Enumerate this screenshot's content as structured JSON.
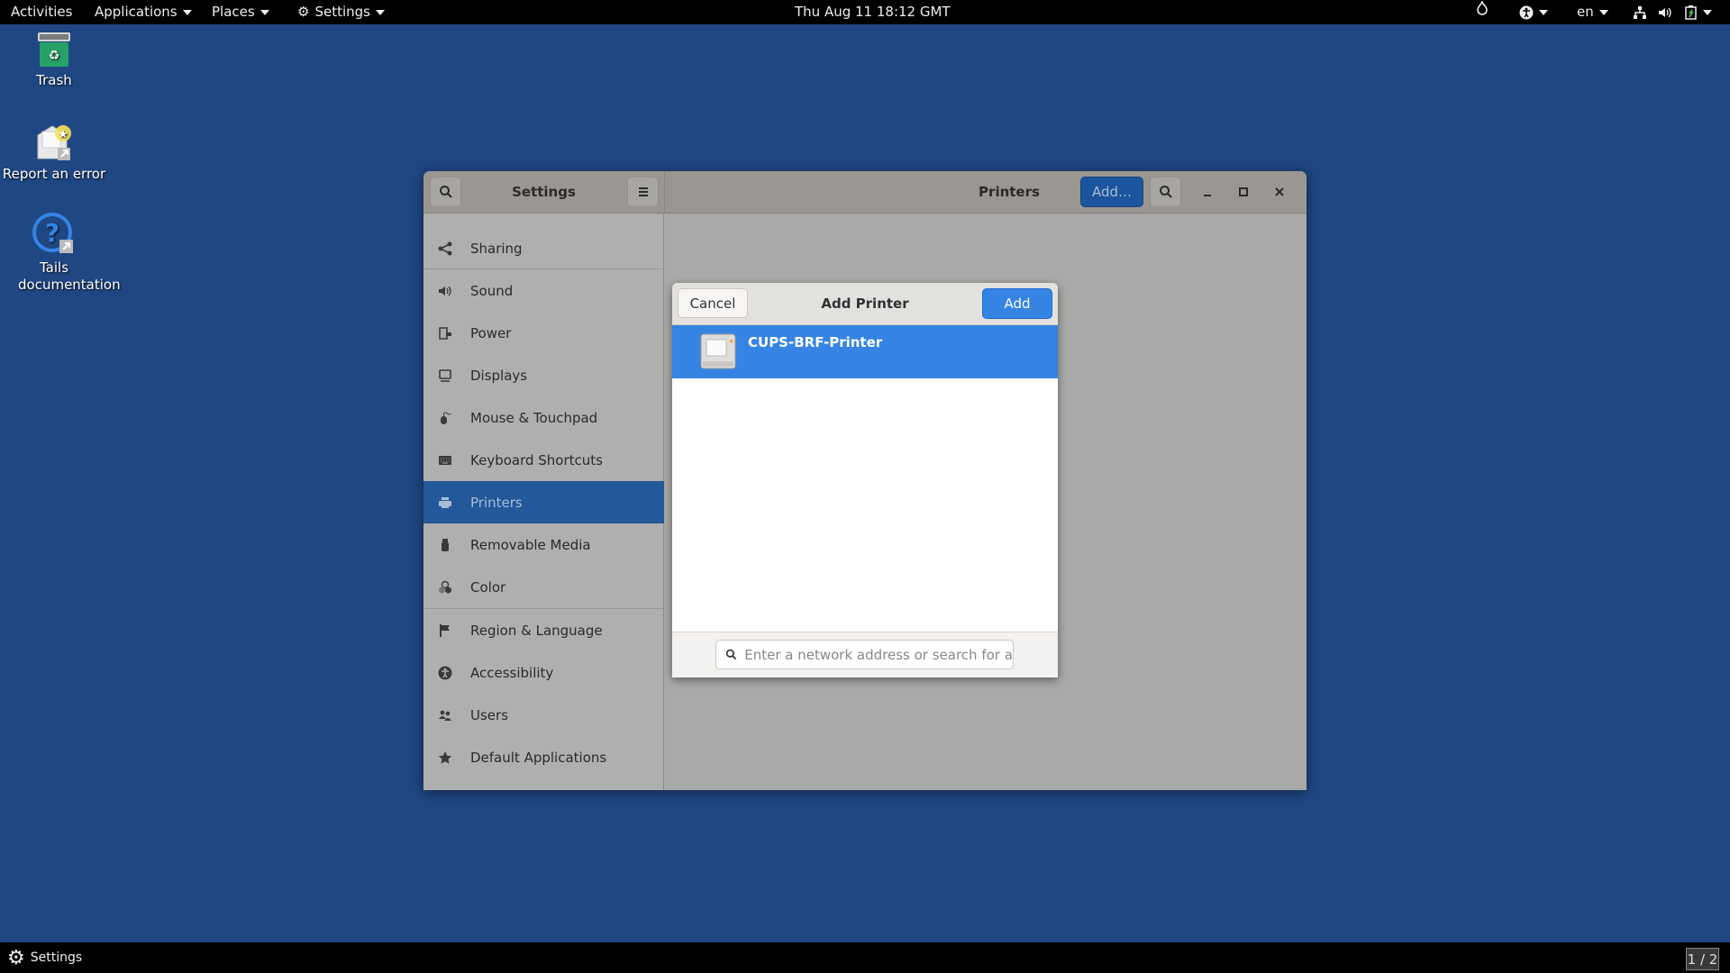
{
  "topbar": {
    "activities": "Activities",
    "applications": "Applications",
    "places": "Places",
    "settings_menu": "Settings",
    "clock": "Thu Aug 11  18:12 GMT",
    "language": "en"
  },
  "desktop": {
    "icons": [
      {
        "label": "Trash"
      },
      {
        "label": "Report an error"
      },
      {
        "label": "Tails documentation"
      }
    ]
  },
  "window": {
    "sidebar_title": "Settings",
    "main_title": "Printers",
    "add_button": "Add…",
    "sidebar": {
      "items": [
        {
          "label": "Sharing",
          "icon": "share-icon"
        },
        {
          "label": "Sound",
          "icon": "speaker-icon"
        },
        {
          "label": "Power",
          "icon": "battery-icon"
        },
        {
          "label": "Displays",
          "icon": "display-icon"
        },
        {
          "label": "Mouse & Touchpad",
          "icon": "mouse-icon"
        },
        {
          "label": "Keyboard Shortcuts",
          "icon": "keyboard-icon"
        },
        {
          "label": "Printers",
          "icon": "printer-icon",
          "selected": true
        },
        {
          "label": "Removable Media",
          "icon": "usb-icon"
        },
        {
          "label": "Color",
          "icon": "color-icon"
        },
        {
          "label": "Region & Language",
          "icon": "flag-icon"
        },
        {
          "label": "Accessibility",
          "icon": "accessibility-icon"
        },
        {
          "label": "Users",
          "icon": "users-icon"
        },
        {
          "label": "Default Applications",
          "icon": "star-icon"
        }
      ]
    }
  },
  "dialog": {
    "title": "Add Printer",
    "cancel": "Cancel",
    "add": "Add",
    "printers": [
      {
        "name": "CUPS-BRF-Printer",
        "selected": true
      }
    ],
    "search_placeholder": "Enter a network address or search for a pri…"
  },
  "taskbar": {
    "app": "Settings",
    "workspace": "1 / 2"
  },
  "colors": {
    "accent": "#3584e4",
    "selected_sidebar": "#23589a",
    "desktop": "#1f4783"
  }
}
